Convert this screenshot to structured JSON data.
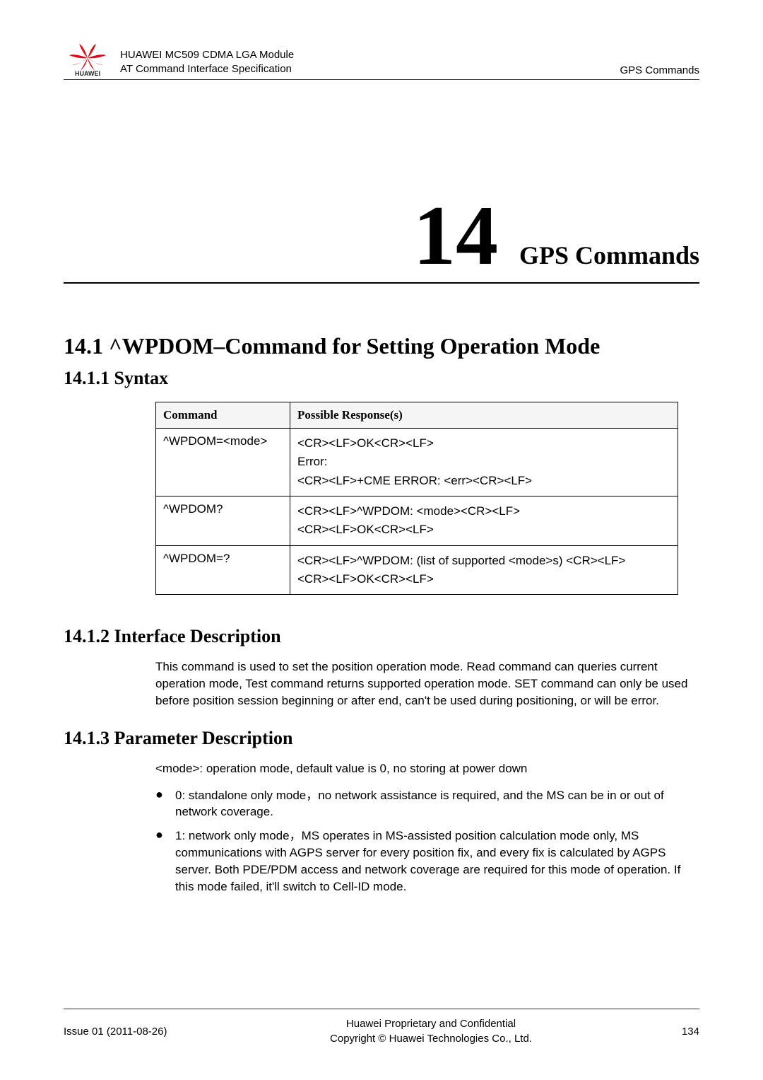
{
  "header": {
    "title1": "HUAWEI MC509 CDMA LGA Module",
    "title2": "AT Command Interface Specification",
    "right": "GPS Commands",
    "logo_text": "HUAWEI"
  },
  "chapter": {
    "number": "14",
    "title": "GPS  Commands"
  },
  "section": {
    "h2": "14.1 ^WPDOM–Command for Setting Operation Mode",
    "syntax": {
      "h3": "14.1.1 Syntax",
      "th_command": "Command",
      "th_response": "Possible Response(s)",
      "rows": [
        {
          "cmd": "^WPDOM=<mode>",
          "resp": [
            "<CR><LF>OK<CR><LF>",
            "Error:",
            "<CR><LF>+CME ERROR: <err><CR><LF>"
          ]
        },
        {
          "cmd": "^WPDOM?",
          "resp": [
            "<CR><LF>^WPDOM: <mode><CR><LF>",
            "<CR><LF>OK<CR><LF>"
          ]
        },
        {
          "cmd": "^WPDOM=?",
          "resp": [
            "<CR><LF>^WPDOM: (list of supported <mode>s) <CR><LF>",
            "<CR><LF>OK<CR><LF>"
          ]
        }
      ]
    },
    "interface": {
      "h3": "14.1.2 Interface Description",
      "para": "This command is used to set the position operation mode. Read command can queries current operation mode, Test command returns supported operation mode. SET command can only be used before position session beginning or after end, can't be used during positioning, or will be error."
    },
    "parameter": {
      "h3": "14.1.3 Parameter Description",
      "intro": "<mode>: operation mode, default value is 0, no storing at power down",
      "bullets": [
        "0: standalone only mode，no network assistance is required, and the MS can be in or out of network coverage.",
        "1: network only mode，MS operates in MS-assisted position calculation mode only, MS communications with AGPS server for every position fix, and every fix is calculated by AGPS server. Both PDE/PDM access and network coverage are required for this mode of operation. If this mode failed, it'll switch to Cell-ID mode."
      ]
    }
  },
  "footer": {
    "left": "Issue 01 (2011-08-26)",
    "center1": "Huawei Proprietary and Confidential",
    "center2": "Copyright © Huawei Technologies Co., Ltd.",
    "right": "134"
  }
}
